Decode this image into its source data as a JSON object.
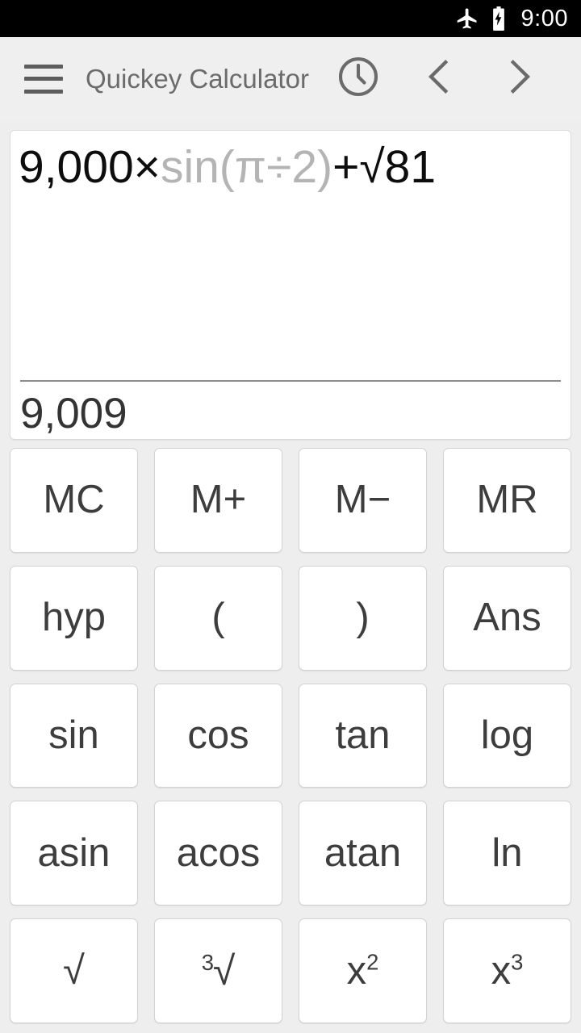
{
  "statusbar": {
    "time": "9:00",
    "icons": [
      "airplane-mode-icon",
      "battery-charging-icon"
    ]
  },
  "toolbar": {
    "menu_icon": "hamburger-menu-icon",
    "title": "Quickey Calculator",
    "history_icon": "clock-history-icon",
    "prev_icon": "chevron-left-icon",
    "next_icon": "chevron-right-icon"
  },
  "display": {
    "expression_segments": [
      {
        "text": "9,000×",
        "dim": false
      },
      {
        "text": "sin(π÷2)",
        "dim": true
      },
      {
        "text": "+√81",
        "dim": false
      }
    ],
    "expression_full": "9,000×sin(π÷2)+√81",
    "result": "9,009"
  },
  "keypad": {
    "rows": [
      [
        {
          "label": "MC",
          "name": "key-memory-clear"
        },
        {
          "label": "M+",
          "name": "key-memory-add"
        },
        {
          "label": "M−",
          "name": "key-memory-subtract"
        },
        {
          "label": "MR",
          "name": "key-memory-recall"
        }
      ],
      [
        {
          "label": "hyp",
          "name": "key-hyp"
        },
        {
          "label": "(",
          "name": "key-open-paren"
        },
        {
          "label": ")",
          "name": "key-close-paren"
        },
        {
          "label": "Ans",
          "name": "key-ans"
        }
      ],
      [
        {
          "label": "sin",
          "name": "key-sin"
        },
        {
          "label": "cos",
          "name": "key-cos"
        },
        {
          "label": "tan",
          "name": "key-tan"
        },
        {
          "label": "log",
          "name": "key-log"
        }
      ],
      [
        {
          "label": "asin",
          "name": "key-asin"
        },
        {
          "label": "acos",
          "name": "key-acos"
        },
        {
          "label": "atan",
          "name": "key-atan"
        },
        {
          "label": "ln",
          "name": "key-ln"
        }
      ],
      [
        {
          "label": "√",
          "name": "key-square-root"
        },
        {
          "label": "³√",
          "name": "key-cube-root",
          "pre_sup": "3",
          "base": "√"
        },
        {
          "label": "x²",
          "name": "key-x-squared",
          "base": "x",
          "sup": "2"
        },
        {
          "label": "x³",
          "name": "key-x-cubed",
          "base": "x",
          "sup": "3"
        }
      ]
    ]
  },
  "colors": {
    "background": "#eeeeee",
    "toolbar": "#efefef",
    "statusbar": "#000000",
    "key_face": "#ffffff",
    "key_border": "#d2d2d2",
    "text_primary": "#3d3d3d",
    "text_dim": "#b4b4b4"
  }
}
